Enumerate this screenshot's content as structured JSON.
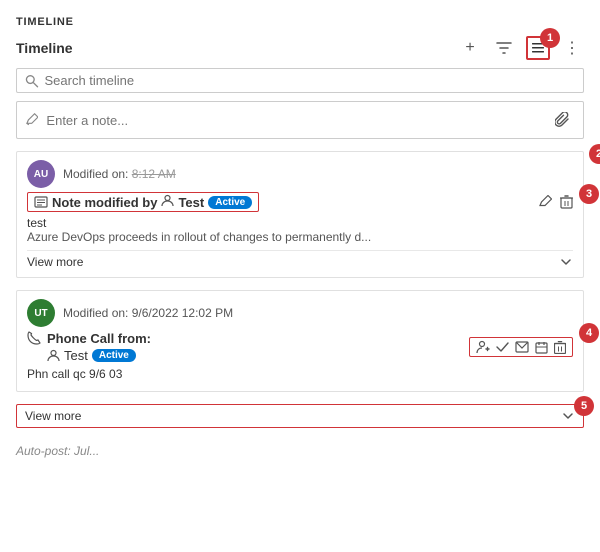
{
  "section": {
    "title": "TIMELINE"
  },
  "toolbar": {
    "label": "Timeline",
    "add_icon": "+",
    "filter_icon": "⊿",
    "list_icon": "≡",
    "more_icon": "⋮",
    "callout_1": "1"
  },
  "search": {
    "placeholder": "Search timeline"
  },
  "note_input": {
    "placeholder": "Enter a note...",
    "attach_icon": "📎"
  },
  "items": [
    {
      "avatar_text": "AU",
      "avatar_class": "avatar-au",
      "modified_on": "Modified on:",
      "time": "8:12 AM",
      "note_modified_label": "Note modified by",
      "user_icon": "👤",
      "user_name": "Test",
      "active_badge": "Active",
      "content_line1": "test",
      "content_line2": "Azure DevOps proceeds in rollout of changes to permanently d...",
      "view_more": "View more",
      "callout_2": "2",
      "callout_3": "3"
    }
  ],
  "phone_item": {
    "avatar_text": "UT",
    "avatar_class": "avatar-ut",
    "modified_on": "Modified on: 9/6/2022 12:02 PM",
    "phone_label": "Phone Call from:",
    "user_icon": "👤",
    "user_name": "Test",
    "active_badge": "Active",
    "content": "Phn call qc 9/6 03",
    "view_more": "View more",
    "callout_4": "4",
    "callout_5": "5"
  },
  "auto_post": {
    "label": "Auto-post: Jul..."
  }
}
